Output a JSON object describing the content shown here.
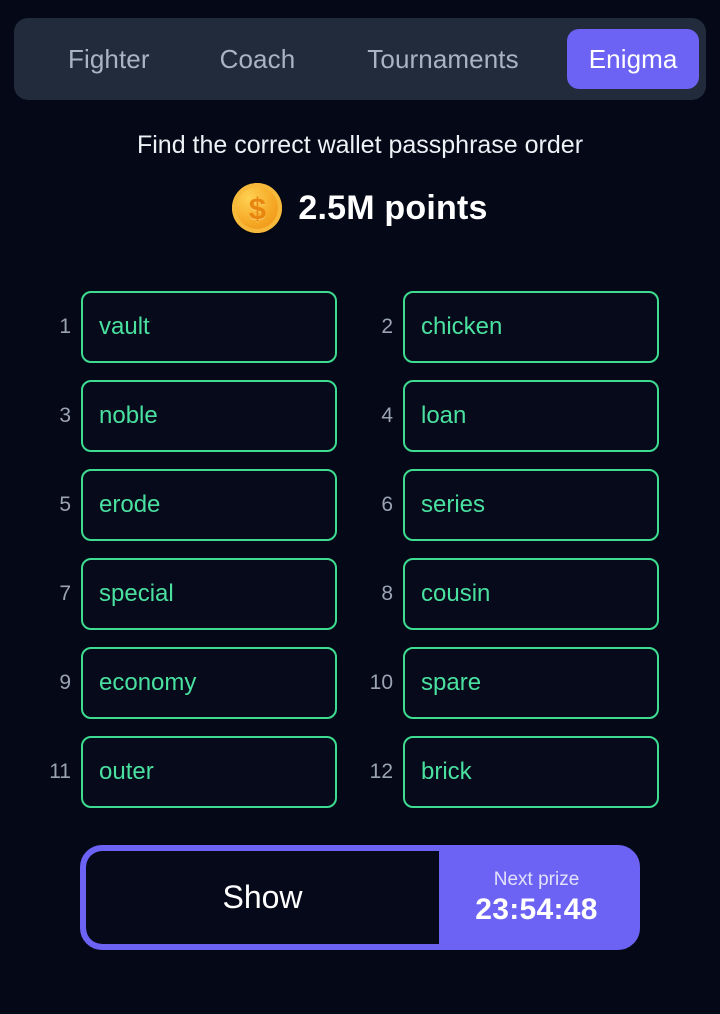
{
  "theme": {
    "page_background": "#050817",
    "tabbar_background": "#222b3b",
    "accent_purple": "#6c63f5",
    "cell_border_green": "#3ddc91",
    "cell_text_green": "#49e0a0",
    "muted_text": "#9aa3b2",
    "coin_gold": "#f5a623"
  },
  "tabs": [
    {
      "label": "Fighter",
      "active": false
    },
    {
      "label": "Coach",
      "active": false
    },
    {
      "label": "Tournaments",
      "active": false
    },
    {
      "label": "Enigma",
      "active": true
    }
  ],
  "header": {
    "title": "Find the correct wallet passphrase order",
    "prize_amount": "2.5M points",
    "coin_icon_glyph": "$"
  },
  "passphrase": {
    "rows": [
      {
        "left": {
          "number": "1",
          "word": "vault"
        },
        "right": {
          "number": "2",
          "word": "chicken"
        }
      },
      {
        "left": {
          "number": "3",
          "word": "noble"
        },
        "right": {
          "number": "4",
          "word": "loan"
        }
      },
      {
        "left": {
          "number": "5",
          "word": "erode"
        },
        "right": {
          "number": "6",
          "word": "series"
        }
      },
      {
        "left": {
          "number": "7",
          "word": "special"
        },
        "right": {
          "number": "8",
          "word": "cousin"
        }
      },
      {
        "left": {
          "number": "9",
          "word": "economy"
        },
        "right": {
          "number": "10",
          "word": "spare"
        }
      },
      {
        "left": {
          "number": "11",
          "word": "outer"
        },
        "right": {
          "number": "12",
          "word": "brick"
        }
      }
    ]
  },
  "footer": {
    "show_label": "Show",
    "next_prize_label": "Next prize",
    "countdown": "23:54:48"
  }
}
